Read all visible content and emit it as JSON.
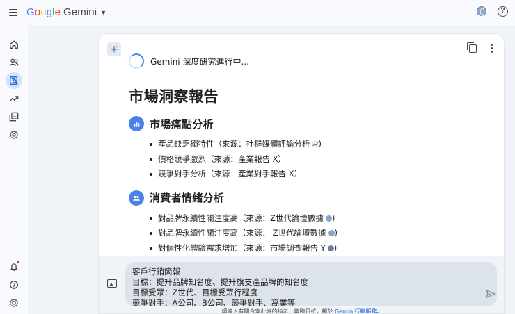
{
  "header": {
    "brand_google": [
      "G",
      "o",
      "o",
      "g",
      "l",
      "e"
    ],
    "brand_product": "Gemini"
  },
  "card": {
    "status_text": "Gemini 深度研究進行中...",
    "report_title": "市場洞察報告",
    "sections": [
      {
        "title": "市場痛點分析",
        "icon": "bar-chart-icon",
        "items": [
          "產品缺乏獨特性（來源：社群媒體評論分析",
          "價格競爭激烈（來源：產業報告 X）",
          "競爭對手分析（來源：產業對手報告 X）"
        ]
      },
      {
        "title": "消費者情緒分析",
        "icon": "group-icon",
        "items": [
          "對品牌永續性關注度高（來源：Z世代論壇數據",
          "對品牌永續性關注度高（來源： Z世代論壇數據",
          "對個性化體驗需求增加（來源：市場調查報告 Y"
        ],
        "item_suffix": ")"
      }
    ]
  },
  "composer": {
    "lines": [
      "客戶行銷簡報",
      "目標：提升品牌知名度、提升旗支產品牌的知名度",
      "目標受眾：Z世代、目標受眾行程度",
      "競爭對手：A公司、B公司、競爭對手、高業等"
    ],
    "disclaimer_text": "請進入有關合富此好的指示，議臨日抗，鄭於",
    "disclaimer_link": "Gemini行銷服務",
    "disclaimer_end": "。"
  },
  "colors": {
    "accent": "#4a83e8",
    "rail_active": "#d3e3fd",
    "background": "#f0f4f9"
  }
}
